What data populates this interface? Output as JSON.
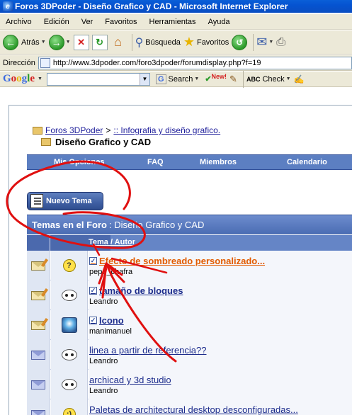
{
  "window": {
    "title": "Foros 3DPoder - Diseño Grafico y CAD - Microsoft Internet Explorer"
  },
  "menu": [
    "Archivo",
    "Edición",
    "Ver",
    "Favoritos",
    "Herramientas",
    "Ayuda"
  ],
  "toolbar": {
    "back_label": "Atrás",
    "search_label": "Búsqueda",
    "favorites_label": "Favoritos"
  },
  "address": {
    "label": "Dirección",
    "url": "http://www.3dpoder.com/foro3dpoder/forumdisplay.php?f=19"
  },
  "google_toolbar": {
    "search_label": "Search",
    "new_badge": "New!",
    "check_label": "Check"
  },
  "breadcrumb": {
    "root": "Foros 3DPoder",
    "separator": ">",
    "parent": ":: Infografia y diseño grafico.",
    "current": "Diseño Grafico y CAD"
  },
  "nav": {
    "items": [
      "Mis Opciones",
      "FAQ",
      "Miembros",
      "Calendario"
    ]
  },
  "new_topic_button": "Nuevo Tema",
  "forum_header": {
    "prefix": "Temas en el Foro",
    "name": ": Diseño Grafico y CAD"
  },
  "columns": {
    "topic_author": "Tema / Autor"
  },
  "threads": [
    {
      "title": "Efecto de sombreado personalizado...",
      "author": "pepe_chafra",
      "bold": true,
      "hot": true,
      "checked": true,
      "status_icon": "hot-folder-icon",
      "post_icon": "question-icon"
    },
    {
      "title": "tamaño de bloques",
      "author": "Leandro",
      "bold": true,
      "hot": false,
      "checked": true,
      "status_icon": "hot-folder-icon",
      "post_icon": "speech-bubble-icon"
    },
    {
      "title": "Icono",
      "author": "manimanuel",
      "bold": true,
      "hot": false,
      "checked": true,
      "status_icon": "hot-folder-icon",
      "post_icon": "application-icon"
    },
    {
      "title": "linea a partir de referencia??",
      "author": "Leandro",
      "bold": false,
      "hot": false,
      "checked": false,
      "status_icon": "envelope-icon",
      "post_icon": "speech-bubble-icon"
    },
    {
      "title": "archicad y 3d studio",
      "author": "Leandro",
      "bold": false,
      "hot": false,
      "checked": false,
      "status_icon": "envelope-icon",
      "post_icon": "speech-bubble-icon"
    },
    {
      "title": "Paletas de architectural desktop desconfiguradas...",
      "author": "",
      "bold": false,
      "hot": false,
      "checked": false,
      "status_icon": "envelope-icon",
      "post_icon": "smiley-icon"
    }
  ],
  "colors": {
    "titlebar": "#0a5fd8",
    "nav_blue": "#5c7fc2",
    "link": "#1c2c8c",
    "hot_link": "#e25b00",
    "scribble": "#e01010"
  }
}
